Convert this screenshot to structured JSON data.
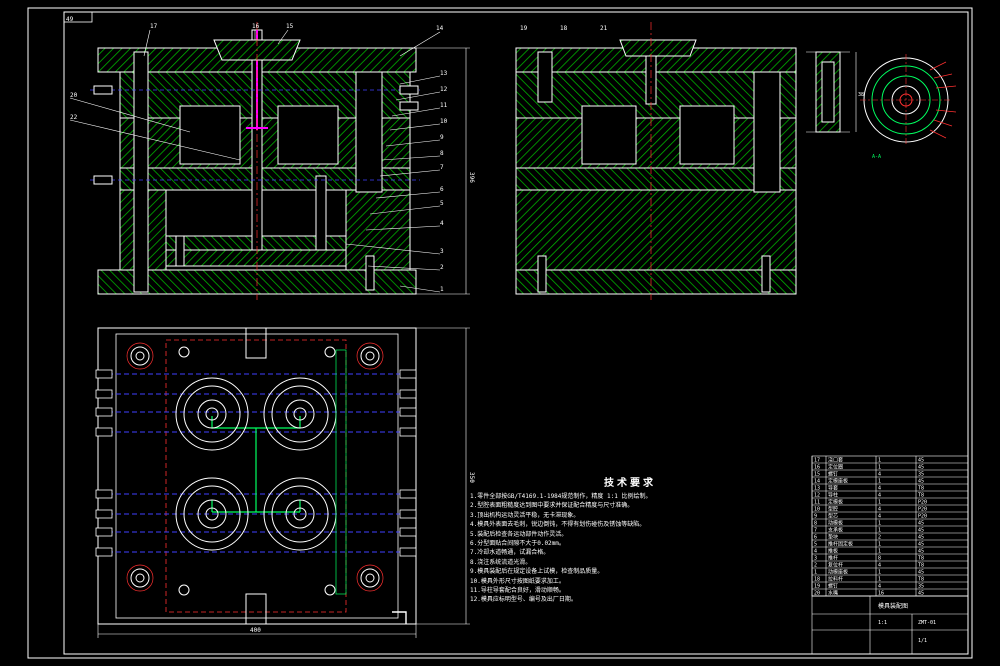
{
  "sheet": {
    "corner_label": "49",
    "technical_requirements_title": "技术要求",
    "technical_requirements": [
      "1.零件全部按GB/T4169.1-1984规范制作，精度 1:1 比例绘制。",
      "2.型腔表面粗糙度达到图中要求并保证配合精度与尺寸准确。",
      "3.顶出机构运动灵活平稳，无卡滞现象。",
      "4.模具外表面去毛刺，锐边倒钝，不得有划伤碰伤及锈蚀等缺陷。",
      "5.装配后检查各运动部件动作灵活。",
      "6.分型面贴合间隙不大于0.02mm。",
      "7.冷却水道畅通，试漏合格。",
      "8.浇注系统流道光滑。",
      "9.模具装配后在规定设备上试模，检查制品质量。",
      "10.模具外形尺寸按图纸要求加工。",
      "11.导柱导套配合良好，滑动顺畅。",
      "12.模具应标明型号、编号及出厂日期。"
    ],
    "dimension_labels": {
      "top_height": "396",
      "plan_height": "350",
      "plan_width": "400",
      "detail_dim": "38"
    },
    "section_labels": {
      "right_detail": "A-A"
    },
    "part_callouts": [
      "17",
      "16",
      "15",
      "14",
      "13",
      "12",
      "11",
      "10",
      "9",
      "8",
      "7",
      "6",
      "5",
      "4",
      "3",
      "2",
      "1",
      "20",
      "22",
      "19",
      "18",
      "21"
    ],
    "bom_rows": [
      [
        "17",
        "浇口套",
        "1",
        "45"
      ],
      [
        "16",
        "定位圈",
        "1",
        "45"
      ],
      [
        "15",
        "螺钉",
        "4",
        "35"
      ],
      [
        "14",
        "定模座板",
        "1",
        "45"
      ],
      [
        "13",
        "导套",
        "4",
        "T8"
      ],
      [
        "12",
        "导柱",
        "4",
        "T8"
      ],
      [
        "11",
        "定模板",
        "1",
        "P20"
      ],
      [
        "10",
        "型腔",
        "4",
        "P20"
      ],
      [
        "9",
        "型芯",
        "4",
        "P20"
      ],
      [
        "8",
        "动模板",
        "1",
        "45"
      ],
      [
        "7",
        "支承板",
        "1",
        "45"
      ],
      [
        "6",
        "垫块",
        "2",
        "45"
      ],
      [
        "5",
        "推杆固定板",
        "1",
        "45"
      ],
      [
        "4",
        "推板",
        "1",
        "45"
      ],
      [
        "3",
        "推杆",
        "8",
        "T8"
      ],
      [
        "2",
        "复位杆",
        "4",
        "T8"
      ],
      [
        "1",
        "动模座板",
        "1",
        "45"
      ],
      [
        "18",
        "拉料杆",
        "1",
        "T8"
      ],
      [
        "19",
        "螺钉",
        "4",
        "35"
      ],
      [
        "20",
        "水嘴",
        "16",
        "45"
      ]
    ],
    "title_block": {
      "title": "模具装配图",
      "drawing_no": "ZMT-01",
      "scale": "1:1",
      "sheet": "1/1"
    }
  },
  "colors": {
    "background": "#000000",
    "outline": "#ffffff",
    "hatch": "#00c000",
    "hidden_line": "#ff3030",
    "dimension": "#ff00ff",
    "cooling": "#4040ff",
    "detail": "#00ff60"
  }
}
